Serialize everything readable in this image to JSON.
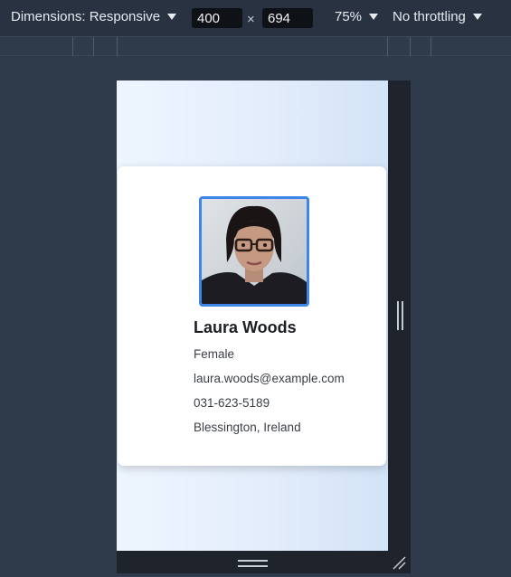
{
  "toolbar": {
    "dimensions_label": "Dimensions: Responsive",
    "width_value": "400",
    "times_symbol": "×",
    "height_value": "694",
    "zoom_label": "75%",
    "throttling_label": "No throttling"
  },
  "profile": {
    "name": "Laura Woods",
    "gender": "Female",
    "email": "laura.woods@example.com",
    "phone": "031-623-5189",
    "location": "Blessington, Ireland"
  },
  "colors": {
    "avatar_border": "#3d85e6",
    "toolbar_bg": "#293241",
    "card_bg": "#ffffff"
  }
}
